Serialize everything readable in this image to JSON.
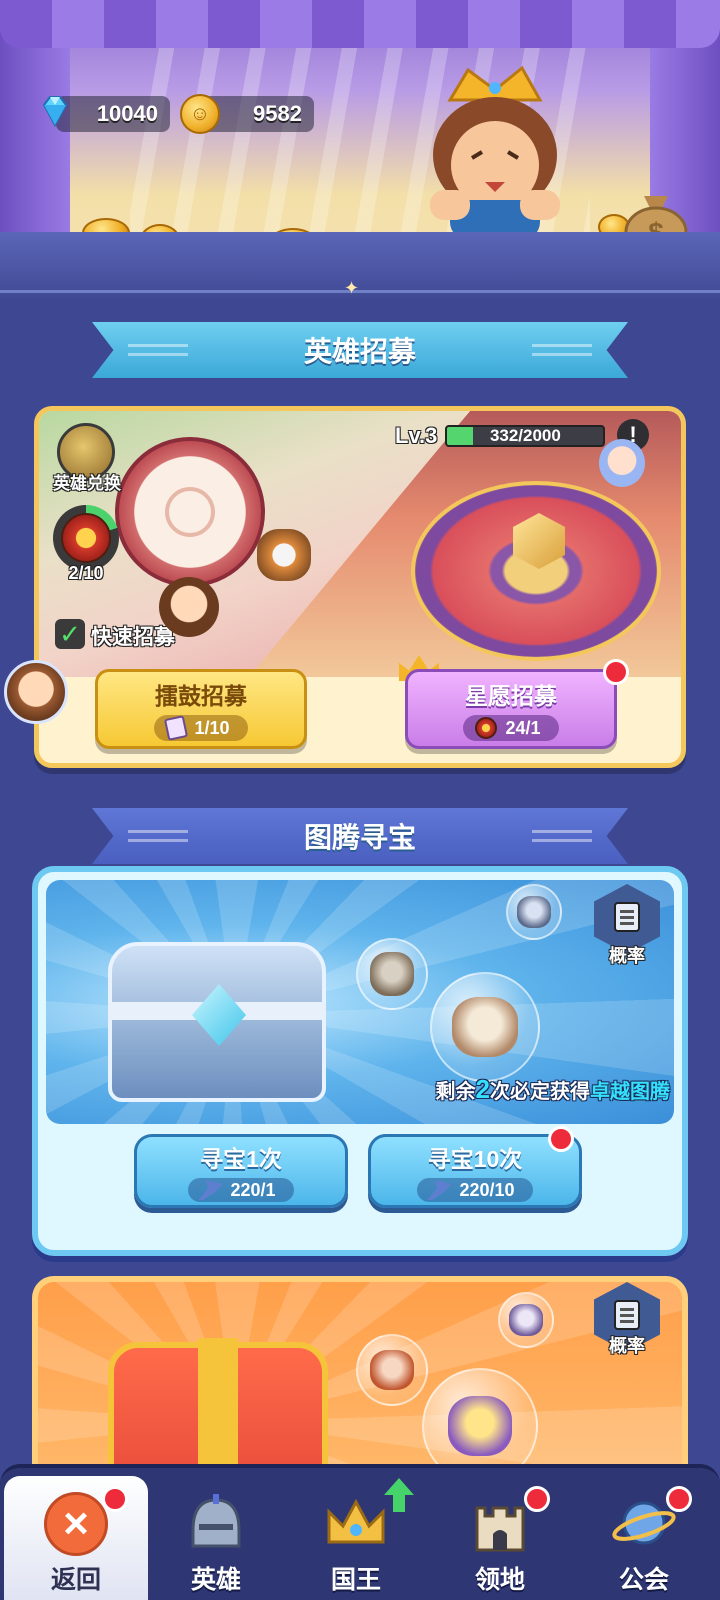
{
  "currency": {
    "gems": "10040",
    "gold": "9582",
    "gem_icon": "diamond-icon",
    "gold_icon": "coin-icon"
  },
  "sections": {
    "recruit_title": "英雄招募",
    "totem_title": "图腾寻宝"
  },
  "recruit": {
    "exchange_label": "英雄兑换",
    "progress_count": "2/10",
    "progress_fraction": 0.2,
    "quick_recruit_label": "快速招募",
    "quick_recruit_checked": true,
    "level_label": "Lv.3",
    "level_progress": "332/2000",
    "level_fraction": 0.166,
    "info_label": "!",
    "drum_button": {
      "label": "擂鼓招募",
      "cost": "1/10"
    },
    "star_button": {
      "label": "星愿招募",
      "cost": "24/1",
      "has_notification": true
    }
  },
  "totem": {
    "probability_label": "概率",
    "guarantee": {
      "prefix": "剩余",
      "count": "2",
      "middle": "次必定获得",
      "reward": "卓越图腾"
    },
    "hunt_once": {
      "label": "寻宝1次",
      "cost": "220/1"
    },
    "hunt_ten": {
      "label": "寻宝10次",
      "cost": "220/10",
      "has_notification": true
    }
  },
  "gold_totem": {
    "probability_label": "概率"
  },
  "nav": {
    "items": [
      {
        "label": "返回",
        "icon": "close-icon",
        "active": true,
        "badge": "red-dot"
      },
      {
        "label": "英雄",
        "icon": "helmet-icon",
        "active": false
      },
      {
        "label": "国王",
        "icon": "crown-icon",
        "active": false,
        "badge": "up-arrow"
      },
      {
        "label": "领地",
        "icon": "castle-icon",
        "active": false,
        "badge": "red-dot"
      },
      {
        "label": "公会",
        "icon": "planet-icon",
        "active": false,
        "badge": "red-dot"
      }
    ]
  },
  "colors": {
    "background": "#3e4892",
    "accent_yellow": "#f6c834",
    "accent_purple": "#c97ee8",
    "accent_blue": "#4cb6ea",
    "notification_red": "#ee2b3a",
    "progress_green": "#54d56d"
  }
}
